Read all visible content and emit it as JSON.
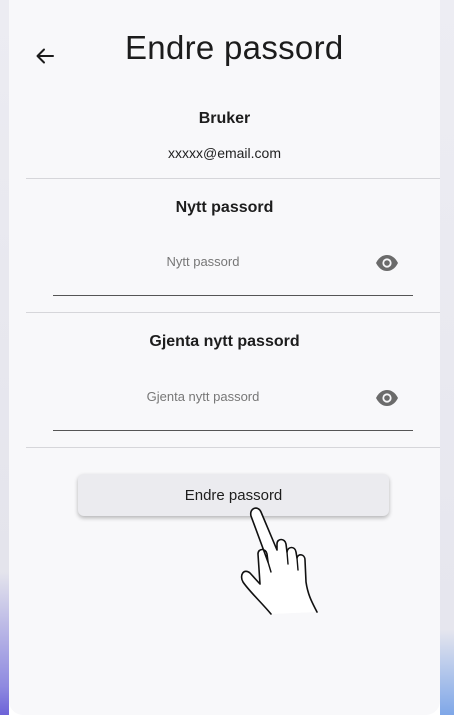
{
  "header": {
    "title": "Endre passord",
    "back_icon": "arrow-left-icon"
  },
  "user_section": {
    "label": "Bruker",
    "email": "xxxxx@email.com"
  },
  "new_password": {
    "label": "Nytt passord",
    "placeholder": "Nytt passord",
    "value": "",
    "toggle_icon": "eye-icon"
  },
  "repeat_password": {
    "label": "Gjenta nytt passord",
    "placeholder": "Gjenta nytt passord",
    "value": "",
    "toggle_icon": "eye-icon"
  },
  "submit": {
    "label": "Endre passord"
  },
  "overlay": {
    "pointer_icon": "hand-pointer-icon"
  },
  "colors": {
    "background": "#f8f8fa",
    "button": "#ebebef",
    "divider": "#d6d6da",
    "underline": "#555555",
    "icon": "#6b6b6b"
  }
}
